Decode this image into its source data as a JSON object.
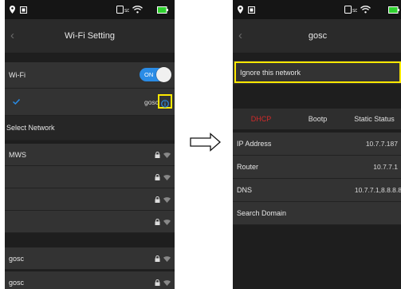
{
  "left_screen": {
    "title": "Wi-Fi Setting",
    "wifi_label": "Wi-Fi",
    "toggle_label": "ON",
    "connected_network": "gosc",
    "section_label": "Select Network",
    "networks": [
      "MWS",
      "",
      "",
      "",
      "gosc",
      "gosc"
    ]
  },
  "right_screen": {
    "title": "gosc",
    "ignore_label": "Ignore this network",
    "tabs": [
      "DHCP",
      "Bootp",
      "Static Status"
    ],
    "fields": [
      {
        "label": "IP Address",
        "value": "10.7.7.187"
      },
      {
        "label": "Router",
        "value": "10.7.7.1"
      },
      {
        "label": "DNS",
        "value": "10.7.7.1,8.8.8.8"
      },
      {
        "label": "Search Domain",
        "value": ""
      }
    ]
  },
  "colors": {
    "accent": "#2a8ce6",
    "highlight": "#ffe800",
    "active_tab": "#d42a2a",
    "battery": "#2fd12f"
  },
  "icons": [
    "location-pin-icon",
    "gallery-icon",
    "sd-card-icon",
    "wifi-icon",
    "battery-icon",
    "back-chevron-icon",
    "checkmark-icon",
    "info-icon",
    "lock-icon",
    "arrow-right-icon"
  ]
}
